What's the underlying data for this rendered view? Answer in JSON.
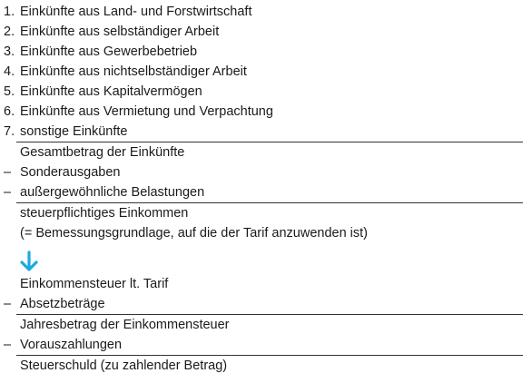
{
  "income_types": [
    {
      "marker": "1.",
      "label": "Einkünfte aus Land- und Forstwirtschaft"
    },
    {
      "marker": "2.",
      "label": "Einkünfte aus selbständiger Arbeit"
    },
    {
      "marker": "3.",
      "label": "Einkünfte aus Gewerbebetrieb"
    },
    {
      "marker": "4.",
      "label": "Einkünfte aus nichtselbständiger Arbeit"
    },
    {
      "marker": "5.",
      "label": "Einkünfte aus Kapitalvermögen"
    },
    {
      "marker": "6.",
      "label": "Einkünfte aus Vermietung und Verpachtung"
    },
    {
      "marker": "7.",
      "label": "sonstige Einkünfte"
    }
  ],
  "total_income": "Gesamtbetrag der Einkünfte",
  "deductions": [
    {
      "marker": "–",
      "label": "Sonderausgaben"
    },
    {
      "marker": "–",
      "label": "außergewöhnliche Belastungen"
    }
  ],
  "taxable_income": "steuerpflichtiges Einkommen",
  "taxable_income_note": "(= Bemessungsgrundlage, auf die der Tarif anzuwenden ist)",
  "arrow_icon": "arrow-down-icon",
  "accent_color": "#1ba9e1",
  "income_tax_tariff": "Einkommensteuer lt. Tarif",
  "credits": {
    "marker": "–",
    "label": "Absetzbeträge"
  },
  "annual_tax": "Jahresbetrag der Einkommensteuer",
  "prepayments": {
    "marker": "–",
    "label": "Vorauszahlungen"
  },
  "tax_liability": "Steuerschuld (zu zahlender Betrag)"
}
